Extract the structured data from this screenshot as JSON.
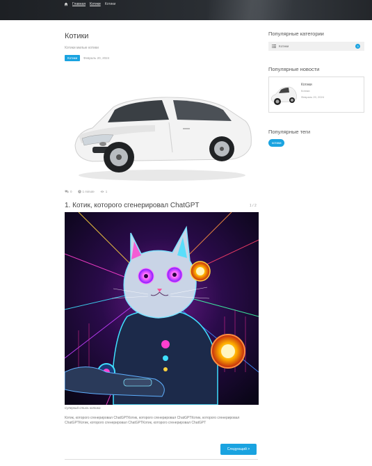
{
  "topbar": {
    "breadcrumbs": [
      "Главная",
      "Котики",
      "Котики"
    ]
  },
  "post": {
    "title": "Котики",
    "subtitle": "Котики милые котики",
    "category_badge": "Котики",
    "date": "Февраль 20, 2024",
    "stats": {
      "comments": "0",
      "read_time": "1 minute",
      "views": "1"
    },
    "item_title": "1. Котик, которого сгенерировал ChatGPT",
    "pager": "1 / 2",
    "image_caption": "Суперкий стиль котика",
    "text": "Котик, которого сгенерировал ChatGPTКотик, которого сгенерировал ChatGPTКотик, которого сгенерировал ChatGPTКотик, которого сгенерировал ChatGPTКотик, которого сгенерировал ChatGPT",
    "next_button": "Следующий >"
  },
  "sidebar": {
    "categories_heading": "Популярные категории",
    "categories": [
      {
        "label": "Котики",
        "count": "3"
      }
    ],
    "news_heading": "Популярные новости",
    "news": [
      {
        "title": "Котики",
        "category": "Котики",
        "date": "Февраль 20, 2024"
      }
    ],
    "tags_heading": "Популярные теги",
    "tags": [
      "котики"
    ]
  },
  "colors": {
    "accent": "#1aa3e0",
    "topbar": "#23262a"
  },
  "icons": [
    "home-icon",
    "comments-icon",
    "clock-icon",
    "eye-icon",
    "list-icon"
  ]
}
